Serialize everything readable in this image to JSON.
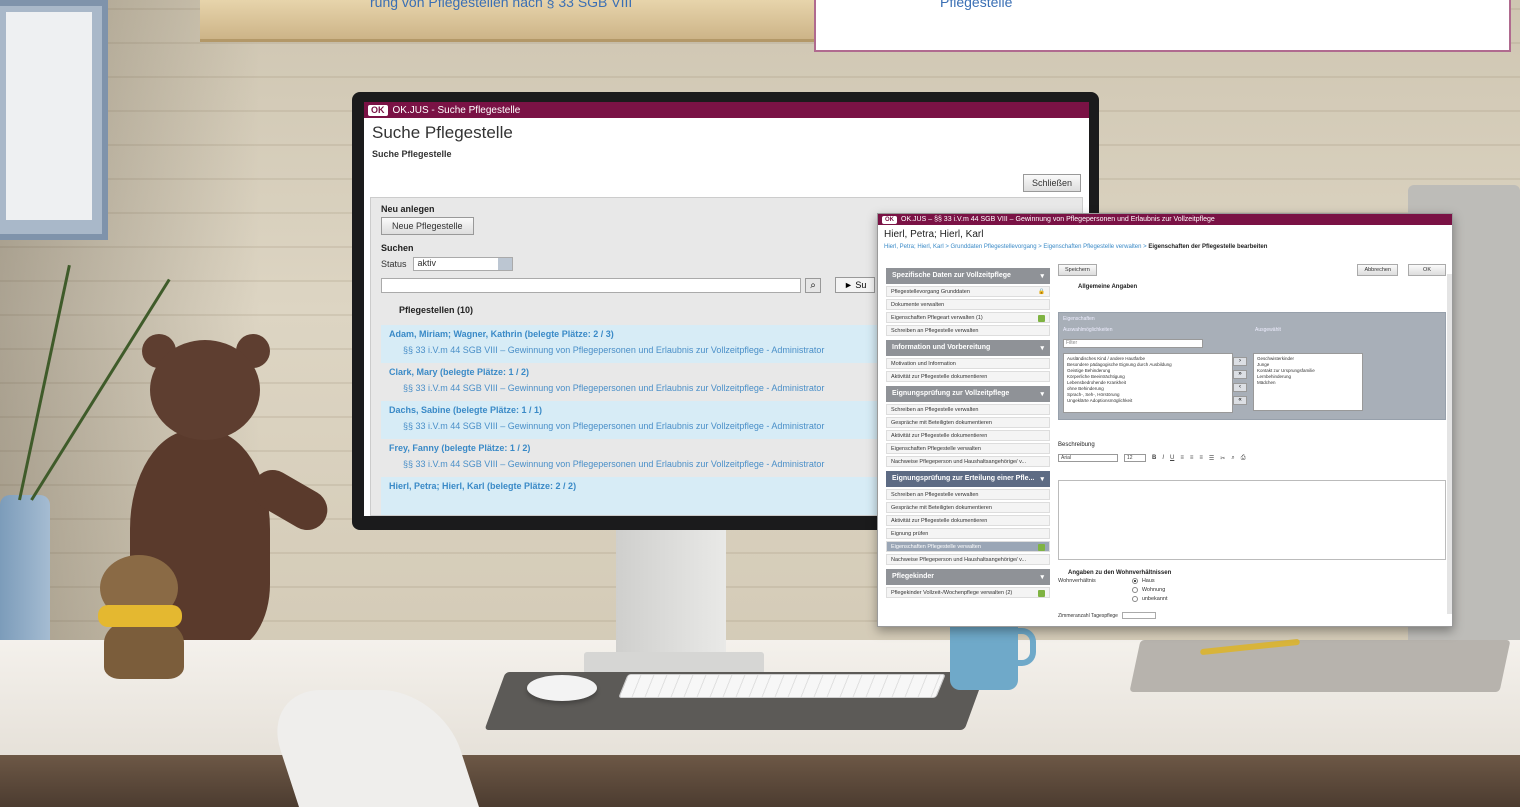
{
  "page_top": {
    "caption_left": "rung von Pflegestellen nach § 33 SGB VIII",
    "caption_right": "Pflegestelle"
  },
  "monitor": {
    "app_logo": "OK",
    "window_title": "OK.JUS - Suche Pflegestelle",
    "page_title": "Suche Pflegestelle",
    "page_subtitle": "Suche Pflegestelle",
    "close_button": "Schließen",
    "new_section_label": "Neu anlegen",
    "new_button": "Neue Pflegestelle",
    "search_section_label": "Suchen",
    "status_label": "Status",
    "status_value": "aktiv",
    "search_button": "► Su",
    "list_heading": "Pflegestellen (10)",
    "items": [
      {
        "name": "Adam, Miriam; Wagner, Kathrin (belegte Plätze: 2 / 3)",
        "desc": "§§ 33 i.V.m 44 SGB VIII – Gewinnung von Pflegepersonen und Erlaubnis zur Vollzeitpflege - Administrator"
      },
      {
        "name": "Clark, Mary (belegte Plätze: 1 / 2)",
        "desc": "§§ 33 i.V.m 44 SGB VIII – Gewinnung von Pflegepersonen und Erlaubnis zur Vollzeitpflege - Administrator"
      },
      {
        "name": "Dachs, Sabine (belegte Plätze: 1 / 1)",
        "desc": "§§ 33 i.V.m 44 SGB VIII – Gewinnung von Pflegepersonen und Erlaubnis zur Vollzeitpflege - Administrator"
      },
      {
        "name": "Frey, Fanny (belegte Plätze: 1 / 2)",
        "desc": "§§ 33 i.V.m 44 SGB VIII – Gewinnung von Pflegepersonen und Erlaubnis zur Vollzeitpflege - Administrator"
      },
      {
        "name": "Hierl, Petra; Hierl, Karl (belegte Plätze: 2 / 2)",
        "desc": ""
      }
    ]
  },
  "overlay": {
    "app_logo": "OK",
    "window_title": "OK.JUS – §§ 33 i.V.m 44 SGB VIII – Gewinnung von Pflegepersonen und Erlaubnis zur Vollzeitpflege",
    "person_name": "Hierl, Petra; Hierl, Karl",
    "breadcrumb": "Hierl, Petra; Hierl, Karl > Grunddaten Pflegestellevorgang > Eigenschaften Pflegestelle verwalten > ",
    "breadcrumb_current": "Eigenschaften der Pflegestelle bearbeiten",
    "save_button": "Speichern",
    "cancel_button": "Abbrechen",
    "ok_button": "OK",
    "section_title": "Allgemeine Angaben",
    "box_label": "Eigenschaften",
    "choices_label": "Auswahlmöglichkeiten",
    "selected_label": "Ausgewählt",
    "filter_placeholder": "Filter",
    "available": [
      "Ausländisches Kind / andere Hautfarbe",
      "Besondere pädagogische Eignung durch Ausbildung",
      "Geistige Behinderung",
      "Körperliche Beeinträchtigung",
      "Lebensbedrohende Krankheit",
      "ohne Behinderung",
      "Sprach-, Seh-, Hörstörung",
      "Ungeklärte Adoptionsmöglichkeit"
    ],
    "selected": [
      "Geschwisterkinder",
      "Junge",
      "Kontakt zur Ursprungsfamilie",
      "Lernbehinderung",
      "Mädchen"
    ],
    "description_label": "Beschreibung",
    "font_name": "Arial",
    "font_size": "12",
    "wohn_heading": "Angaben zu den Wohnverhältnissen",
    "wohn_label": "Wohnverhältnis",
    "wohn_options": [
      "Haus",
      "Wohnung",
      "unbekannt"
    ],
    "zimmer_label": "Zimmeranzahl Tagespflege",
    "groups": [
      {
        "title": "Spezifische Daten zur Vollzeitpflege",
        "links": [
          "Pflegestellevorgang Grunddaten",
          "Dokumente verwalten",
          "Eigenschaften Pflegeart verwalten (1)",
          "Schreiben an Pflegestelle verwalten"
        ]
      },
      {
        "title": "Information und Vorbereitung",
        "links": [
          "Motivation und Information",
          "Aktivität zur Pflegestelle dokumentieren"
        ]
      },
      {
        "title": "Eignungsprüfung zur Vollzeitpflege",
        "links": [
          "Schreiben an Pflegestelle verwalten",
          "Gespräche mit Beteiligten dokumentieren",
          "Aktivität zur Pflegestelle dokumentieren",
          "Eigenschaften Pflegestelle verwalten",
          "Nachweise Pflegeperson und Haushaltsangehörige/ v..."
        ]
      },
      {
        "title": "Eignungsprüfung zur Erteilung einer Pfle...",
        "links": [
          "Schreiben an Pflegestelle verwalten",
          "Gespräche mit Beteiligten dokumentieren",
          "Aktivität zur Pflegestelle dokumentieren",
          "Eignung prüfen",
          "Eigenschaften Pflegestelle verwalten",
          "Nachweise Pflegeperson und Haushaltsangehörige/ v..."
        ]
      },
      {
        "title": "Pflegekinder",
        "links": [
          "Pflegekinder Vollzeit-/Wochenpflege verwalten (2)"
        ]
      }
    ]
  }
}
